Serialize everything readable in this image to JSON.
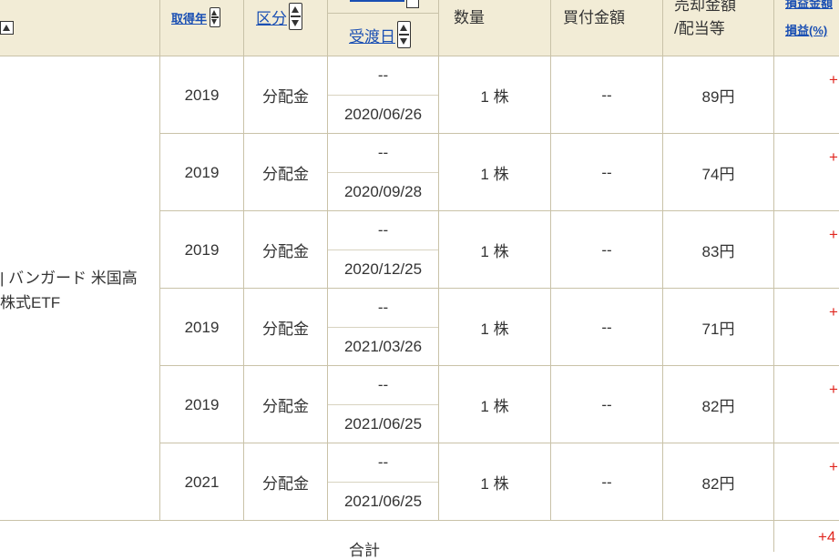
{
  "header": {
    "acquired_year": "取得年",
    "category": "区分",
    "delivery_date": "受渡日",
    "quantity": "数量",
    "buy_amount": "買付金額",
    "sell_amount_line1": "売却金額",
    "sell_amount_line2": "/配当等",
    "pl_amount": "損益金額",
    "pl_pct": "損益(%)"
  },
  "security_name_line1": "| バンガード 米国高",
  "security_name_line2": "株式ETF",
  "rows": [
    {
      "year": "2019",
      "category": "分配金",
      "top": "--",
      "date": "2020/06/26",
      "qty": "1 株",
      "buy": "--",
      "sell": "89円",
      "pl": "+"
    },
    {
      "year": "2019",
      "category": "分配金",
      "top": "--",
      "date": "2020/09/28",
      "qty": "1 株",
      "buy": "--",
      "sell": "74円",
      "pl": "+"
    },
    {
      "year": "2019",
      "category": "分配金",
      "top": "--",
      "date": "2020/12/25",
      "qty": "1 株",
      "buy": "--",
      "sell": "83円",
      "pl": "+"
    },
    {
      "year": "2019",
      "category": "分配金",
      "top": "--",
      "date": "2021/03/26",
      "qty": "1 株",
      "buy": "--",
      "sell": "71円",
      "pl": "+"
    },
    {
      "year": "2019",
      "category": "分配金",
      "top": "--",
      "date": "2021/06/25",
      "qty": "1 株",
      "buy": "--",
      "sell": "82円",
      "pl": "+"
    },
    {
      "year": "2021",
      "category": "分配金",
      "top": "--",
      "date": "2021/06/25",
      "qty": "1 株",
      "buy": "--",
      "sell": "82円",
      "pl": "+"
    }
  ],
  "footer": {
    "total_label": "合計",
    "total_pl": "+4"
  }
}
